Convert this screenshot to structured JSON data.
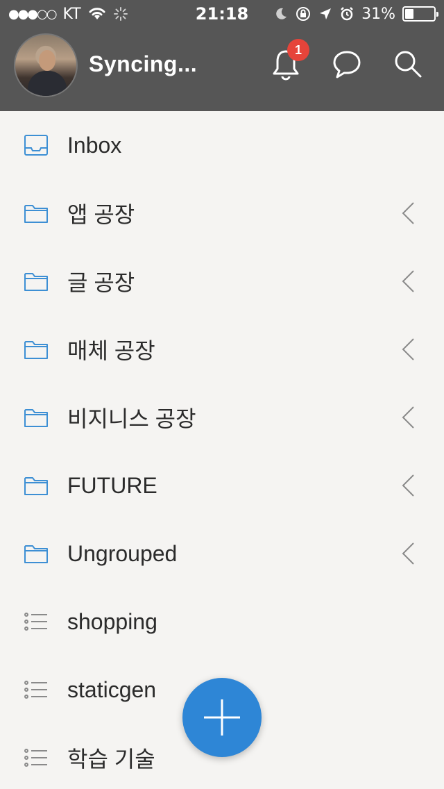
{
  "status_bar": {
    "signal": "●●●○○",
    "carrier": "KT",
    "time": "21:18",
    "battery_percent": "31%",
    "battery_level": 0.31
  },
  "header": {
    "title": "Syncing...",
    "notification_count": "1"
  },
  "items": [
    {
      "label": "Inbox",
      "icon": "inbox-icon",
      "has_chevron": false
    },
    {
      "label": "앱 공장",
      "icon": "folder-icon",
      "has_chevron": true
    },
    {
      "label": "글 공장",
      "icon": "folder-icon",
      "has_chevron": true
    },
    {
      "label": "매체 공장",
      "icon": "folder-icon",
      "has_chevron": true
    },
    {
      "label": "비지니스 공장",
      "icon": "folder-icon",
      "has_chevron": true
    },
    {
      "label": "FUTURE",
      "icon": "folder-icon",
      "has_chevron": true
    },
    {
      "label": "Ungrouped",
      "icon": "folder-icon",
      "has_chevron": true
    },
    {
      "label": "shopping",
      "icon": "list-icon",
      "has_chevron": false
    },
    {
      "label": "staticgen",
      "icon": "list-icon",
      "has_chevron": false
    },
    {
      "label": "학습 기술",
      "icon": "list-icon",
      "has_chevron": false
    }
  ],
  "colors": {
    "header_bg": "#565656",
    "list_bg": "#f5f4f2",
    "accent_blue": "#2e86d6",
    "badge_red": "#e6443a"
  }
}
